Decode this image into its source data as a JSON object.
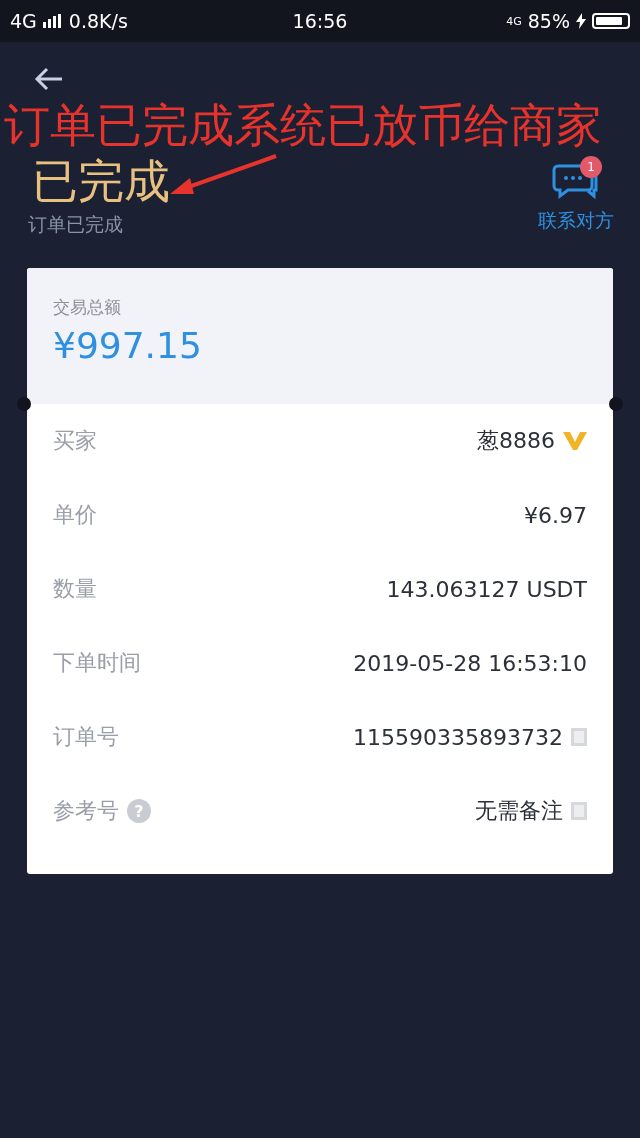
{
  "status_bar": {
    "network": "4G",
    "speed": "0.8K/s",
    "time": "16:56",
    "network_2": "4G",
    "battery": "85%"
  },
  "annotation": {
    "text": "订单已完成系统已放币给商家"
  },
  "header": {
    "status": "已完成",
    "subtitle": "订单已完成",
    "contact": {
      "label": "联系对方",
      "badge": "1"
    }
  },
  "total": {
    "label": "交易总额",
    "amount": "¥997.15"
  },
  "rows": [
    {
      "label": "买家",
      "value": "葱8886",
      "vip_badge": true,
      "copyable": false
    },
    {
      "label": "单价",
      "value": "¥6.97",
      "vip_badge": false,
      "copyable": false
    },
    {
      "label": "数量",
      "value": "143.063127 USDT",
      "vip_badge": false,
      "copyable": false
    },
    {
      "label": "下单时间",
      "value": "2019-05-28 16:53:10",
      "vip_badge": false,
      "copyable": false
    },
    {
      "label": "订单号",
      "value": "115590335893732",
      "vip_badge": false,
      "copyable": true
    },
    {
      "label": "参考号",
      "help": "?",
      "value": "无需备注",
      "vip_badge": false,
      "copyable": true
    }
  ]
}
